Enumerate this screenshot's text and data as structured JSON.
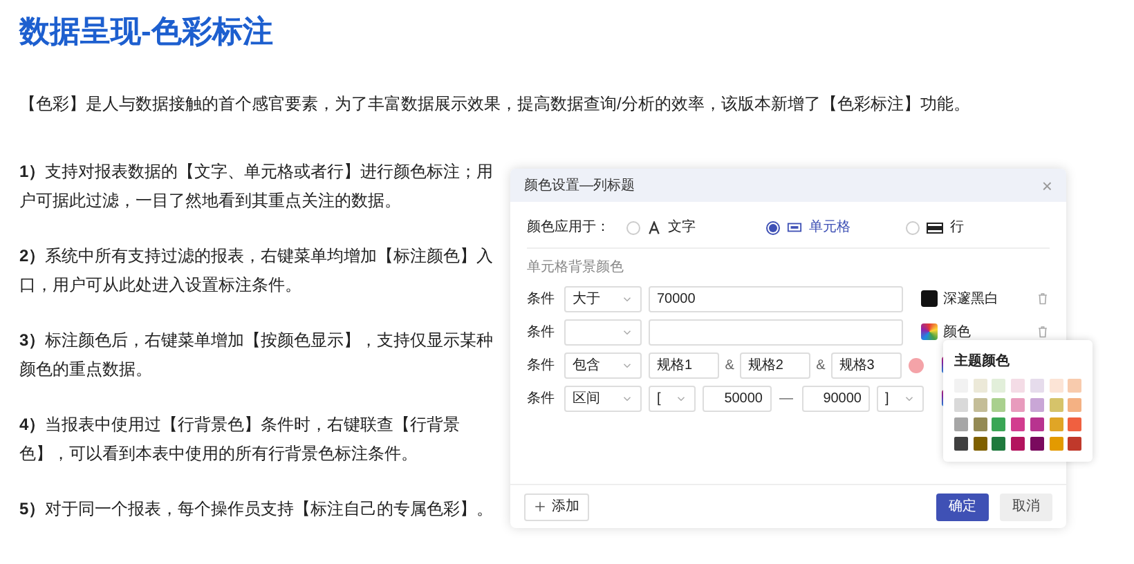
{
  "title": "数据呈现-色彩标注",
  "intro": "【色彩】是人与数据接触的首个感官要素，为了丰富数据展示效果，提高数据查询/分析的效率，该版本新增了【色彩标注】功能。",
  "points": [
    {
      "number": "1）",
      "text": "支持对报表数据的【文字、单元格或者行】进行颜色标注；用户可据此过滤，一目了然地看到其重点关注的数据。"
    },
    {
      "number": "2）",
      "text": "系统中所有支持过滤的报表，右键菜单均增加【标注颜色】入口，用户可从此处进入设置标注条件。"
    },
    {
      "number": "3）",
      "text": "标注颜色后，右键菜单增加【按颜色显示】，支持仅显示某种颜色的重点数据。"
    },
    {
      "number": "4）",
      "text": "当报表中使用过【行背景色】条件时，右键联查【行背景色】，可以看到本表中使用的所有行背景色标注条件。"
    },
    {
      "number": "5）",
      "text": "对于同一个报表，每个操作员支持【标注自己的专属色彩】。"
    }
  ],
  "dialog": {
    "title": "颜色设置—列标题",
    "close": "×",
    "apply_label": "颜色应用于：",
    "apply_options": [
      {
        "label": "文字",
        "kind": "text",
        "selected": false
      },
      {
        "label": "单元格",
        "kind": "cell",
        "selected": true
      },
      {
        "label": "行",
        "kind": "row",
        "selected": false
      }
    ],
    "section": "单元格背景颜色",
    "conditions": [
      {
        "kind": "single",
        "label": "条件",
        "operator": "大于",
        "value": "70000",
        "swatch_multicolor": false,
        "swatch_label": "深邃黑白"
      },
      {
        "kind": "single",
        "label": "条件",
        "swatch_multicolor": true,
        "swatch_label": "颜色"
      },
      {
        "kind": "multi",
        "label": "条件",
        "operator": "包含",
        "values": [
          "规格1",
          "规格2",
          "规格3"
        ],
        "joiner": "&",
        "swatch_multicolor": true
      },
      {
        "kind": "range",
        "label": "条件",
        "operator": "区间",
        "open": "[",
        "from": "50000",
        "dash": "—",
        "to": "90000",
        "close": "]",
        "swatch_multicolor": true
      }
    ],
    "palette": {
      "title": "主题颜色",
      "swatches": [
        {
          "color": "#f2f2f2"
        },
        {
          "color": "#ece9d8"
        },
        {
          "color": "#e2efda"
        },
        {
          "color": "#f4dce6"
        },
        {
          "color": "#e6dcec"
        },
        {
          "color": "#fce4d6"
        },
        {
          "color": "#f8cbad"
        },
        {
          "color": "#d9d9d9"
        },
        {
          "color": "#c4bd97"
        },
        {
          "color": "#a9d08e"
        },
        {
          "color": "#e89bbd"
        },
        {
          "color": "#c9a6d6"
        },
        {
          "color": "#d6c36a"
        },
        {
          "color": "#f4b183"
        },
        {
          "color": "#a6a6a6"
        },
        {
          "color": "#948a54"
        },
        {
          "color": "#3aa655"
        },
        {
          "color": "#d23d8f"
        },
        {
          "color": "#b8338f"
        },
        {
          "color": "#e0a526"
        },
        {
          "color": "#f06040"
        },
        {
          "color": "#404040"
        },
        {
          "color": "#7f6000"
        },
        {
          "color": "#1f7a3d"
        },
        {
          "color": "#b3145e"
        },
        {
          "color": "#7a0a5e"
        },
        {
          "color": "#e39a00"
        },
        {
          "color": "#c0392b"
        }
      ]
    },
    "add_button": "添加",
    "ok_button": "确定",
    "cancel_button": "取消"
  }
}
